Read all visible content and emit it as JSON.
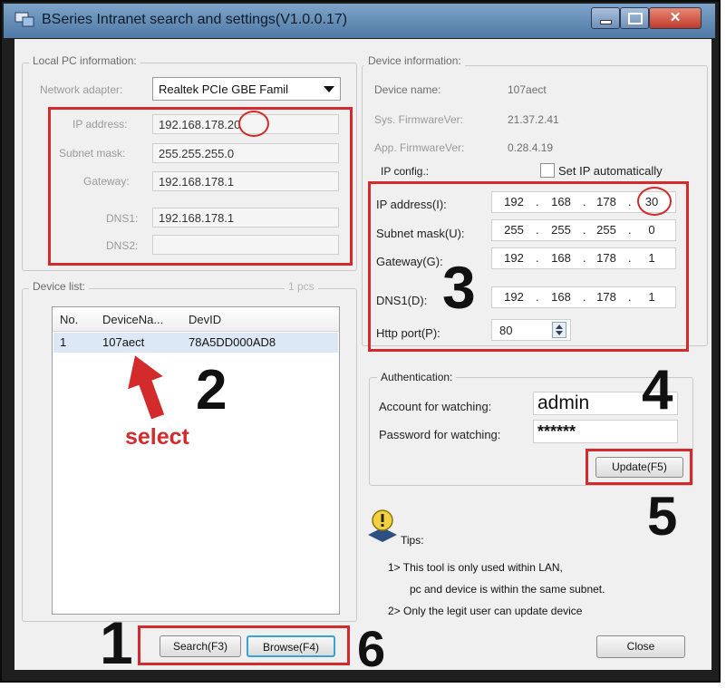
{
  "window": {
    "title": "BSeries Intranet search and settings(V1.0.0.17)"
  },
  "local_pc": {
    "group_label": "Local PC information:",
    "network_adapter_label": "Network adapter:",
    "network_adapter_value": "Realtek PCIe GBE Famil",
    "ip_label": "IP address:",
    "ip_value": "192.168.178.",
    "ip_last": "20",
    "subnet_label": "Subnet mask:",
    "subnet_value": "255.255.255.0",
    "gateway_label": "Gateway:",
    "gateway_value": "192.168.178.1",
    "dns1_label": "DNS1:",
    "dns1_value": "192.168.178.1",
    "dns2_label": "DNS2:",
    "dns2_value": ""
  },
  "device_list": {
    "group_label": "Device list:",
    "count": "1 pcs",
    "columns": [
      "No.",
      "DeviceNa...",
      "DevID"
    ],
    "rows": [
      {
        "no": "1",
        "name": "107aect",
        "devid": "78A5DD000AD8"
      }
    ]
  },
  "device_info": {
    "group_label": "Device information:",
    "name_label": "Device name:",
    "name_value": "107aect",
    "sys_fw_label": "Sys. FirmwareVer:",
    "sys_fw_value": "21.37.2.41",
    "app_fw_label": "App. FirmwareVer:",
    "app_fw_value": "0.28.4.19",
    "ipconfig_label": "IP config.:",
    "set_ip_auto_label": "Set IP automatically",
    "set_ip_auto_checked": false,
    "ip_label": "IP address(I):",
    "ip": [
      "192",
      "168",
      "178",
      "30"
    ],
    "subnet_label": "Subnet mask(U):",
    "subnet": [
      "255",
      "255",
      "255",
      "0"
    ],
    "gateway_label": "Gateway(G):",
    "gateway": [
      "192",
      "168",
      "178",
      "1"
    ],
    "dns1_label": "DNS1(D):",
    "dns1": [
      "192",
      "168",
      "178",
      "1"
    ],
    "http_port_label": "Http port(P):",
    "http_port": "80"
  },
  "auth": {
    "group_label": "Authentication:",
    "account_label": "Account for watching:",
    "account_value": "admin",
    "password_label": "Password for watching:",
    "password_value": "******"
  },
  "buttons": {
    "update": "Update(F5)",
    "search": "Search(F3)",
    "browse": "Browse(F4)",
    "close": "Close"
  },
  "tips": {
    "title": "Tips:",
    "line1": "1> This tool is only used within LAN,",
    "line2": "pc and device is within the same subnet.",
    "line3": "2> Only the legit user can update  device"
  },
  "annotations": {
    "step1": "1",
    "step2": "2",
    "step3": "3",
    "step4": "4",
    "step5": "5",
    "step6": "6",
    "select": "select"
  },
  "colors": {
    "annotation_red": "#d32b2b",
    "title_blue": "#5f89b3"
  },
  "icons": [
    "app-icon",
    "minimize-icon",
    "maximize-icon",
    "close-icon",
    "dropdown-arrow-icon",
    "spinner-icon",
    "tips-icon",
    "arrow-annotation-icon"
  ]
}
